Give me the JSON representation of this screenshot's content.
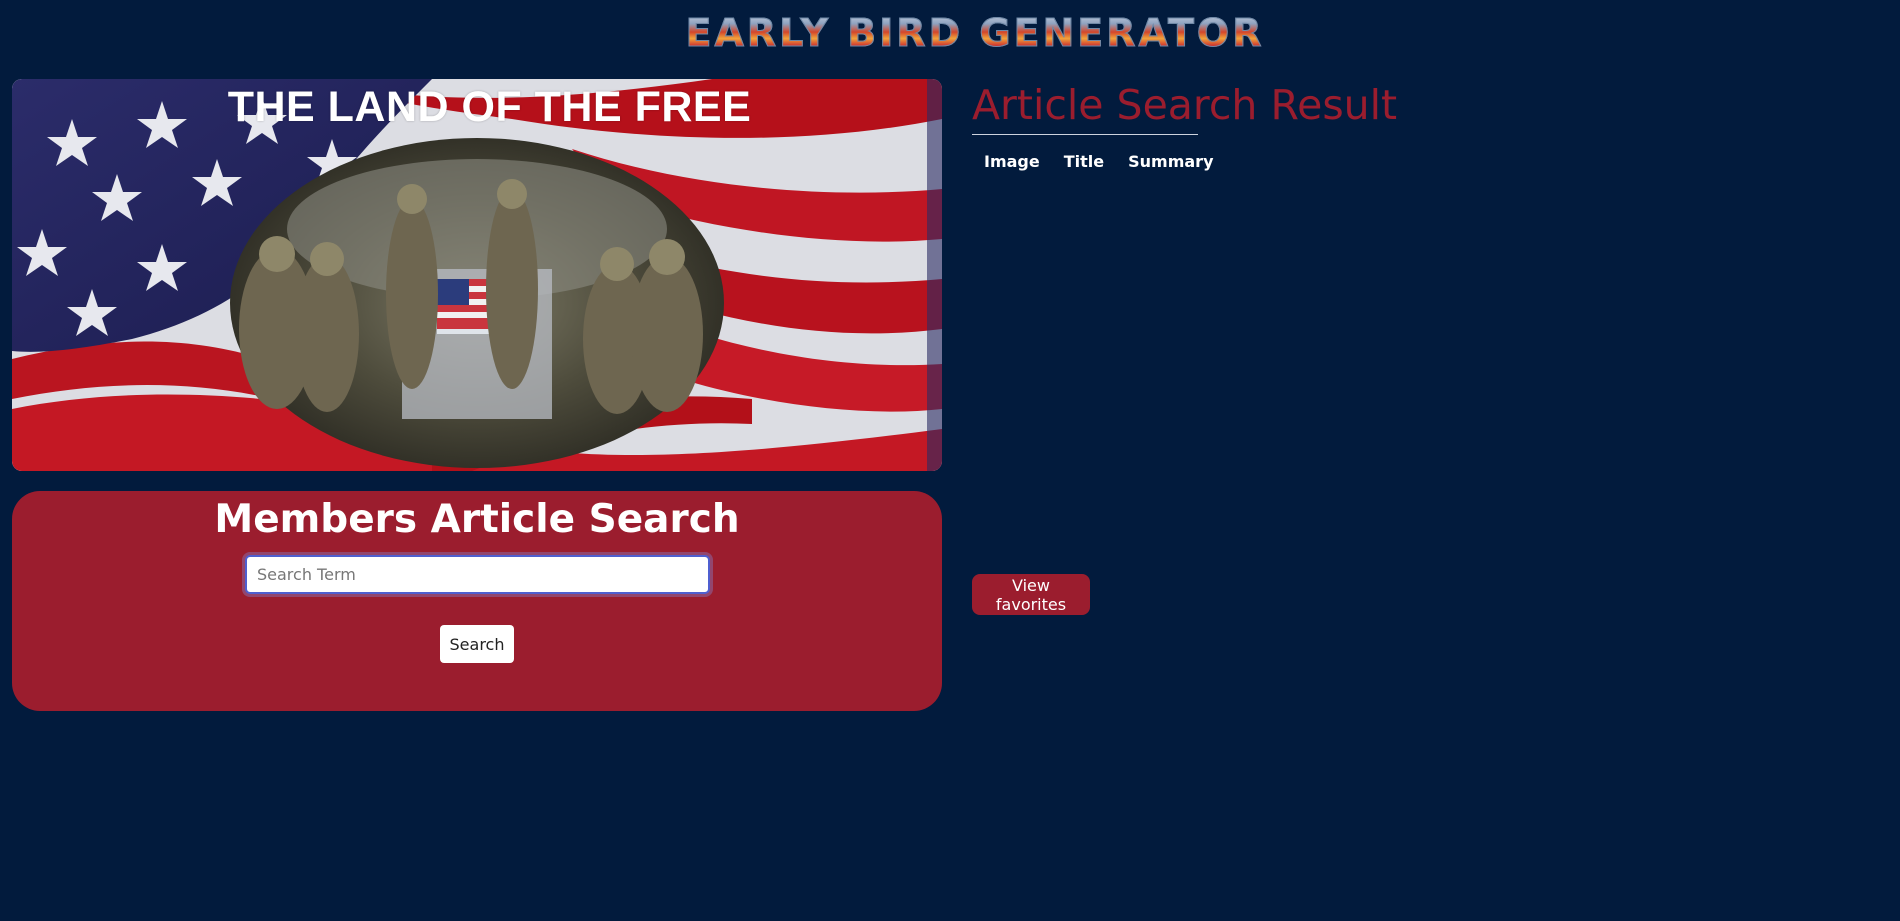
{
  "header": {
    "logo_text": "EARLY BIRD GENERATOR"
  },
  "hero": {
    "title": "THE LAND OF THE FREE"
  },
  "search": {
    "title": "Members Article Search",
    "placeholder": "Search Term",
    "value": "",
    "button_label": "Search"
  },
  "results": {
    "title": "Article Search Result",
    "columns": [
      "Image",
      "Title",
      "Summary"
    ],
    "rows": []
  },
  "favorites": {
    "button_label": "View favorites"
  },
  "colors": {
    "page_background": "#021b3d",
    "accent_red": "#9b1d2e",
    "white": "#ffffff",
    "input_focus_border": "#4f5fd0"
  }
}
